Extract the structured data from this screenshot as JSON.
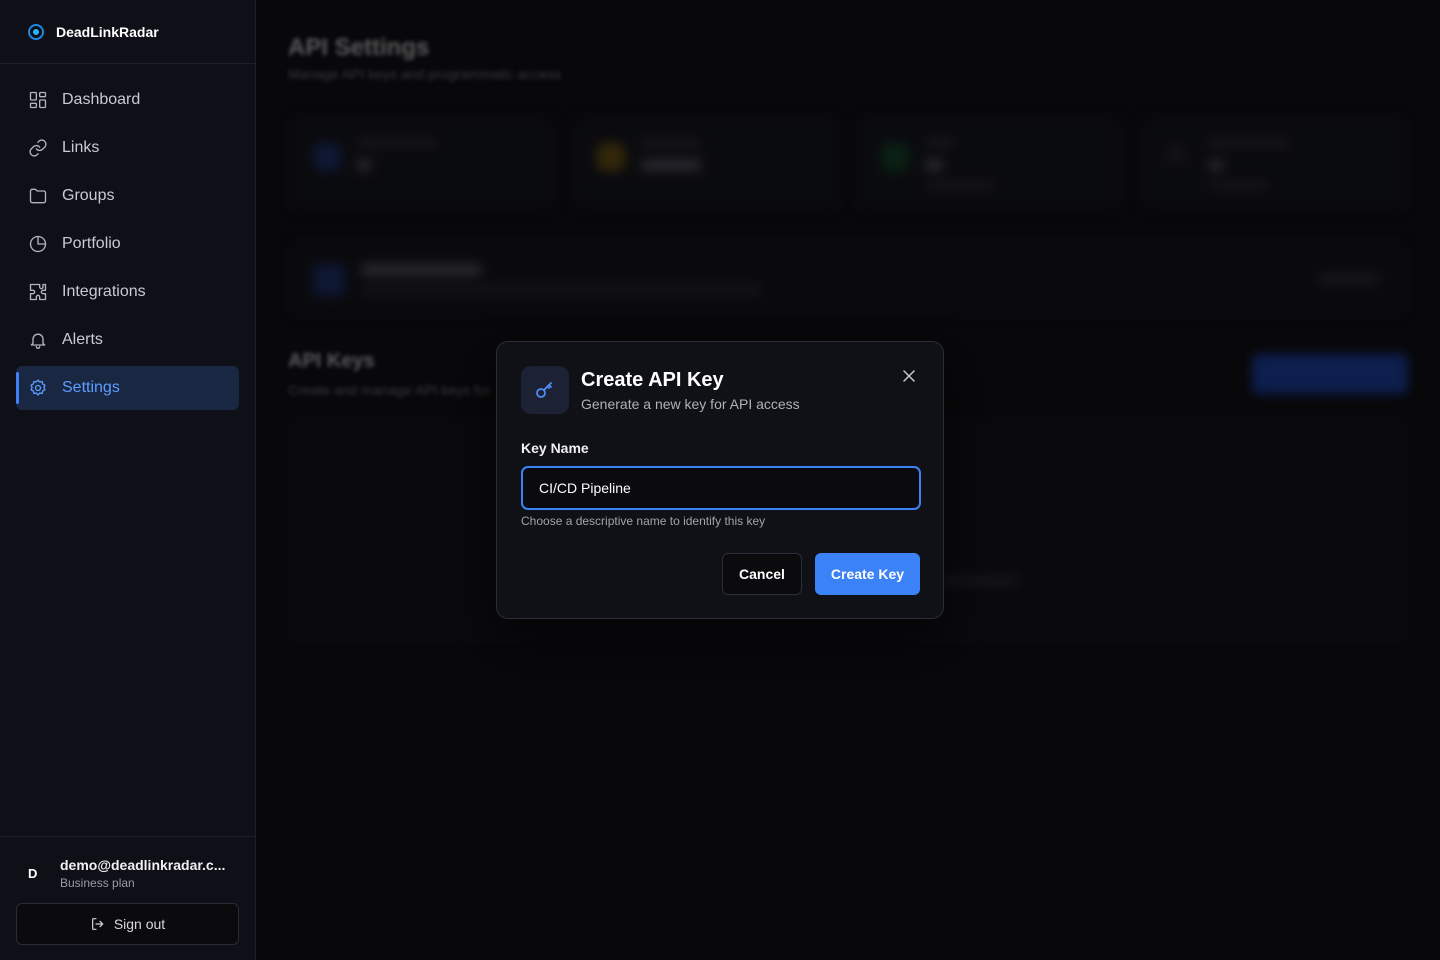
{
  "brand": {
    "name": "DeadLinkRadar",
    "icon": "radar-icon"
  },
  "sidebar": {
    "items": [
      {
        "label": "Dashboard",
        "icon": "grid-icon",
        "active": false
      },
      {
        "label": "Links",
        "icon": "link-icon",
        "active": false
      },
      {
        "label": "Groups",
        "icon": "folder-icon",
        "active": false
      },
      {
        "label": "Portfolio",
        "icon": "pie-chart-icon",
        "active": false
      },
      {
        "label": "Integrations",
        "icon": "puzzle-icon",
        "active": false
      },
      {
        "label": "Alerts",
        "icon": "bell-icon",
        "active": false
      },
      {
        "label": "Settings",
        "icon": "gear-icon",
        "active": true
      }
    ]
  },
  "user": {
    "initial": "D",
    "email": "demo@deadlinkradar.c...",
    "plan": "Business plan",
    "signout_label": "Sign out"
  },
  "page": {
    "title": "API Settings",
    "subtitle": "Manage API keys and programmatic access",
    "keys_title": "API Keys",
    "keys_subtitle": "Create and manage API keys for"
  },
  "modal": {
    "title": "Create API Key",
    "subtitle": "Generate a new key for API access",
    "field_label": "Key Name",
    "field_value": "CI/CD Pipeline",
    "field_help": "Choose a descriptive name to identify this key",
    "cancel_label": "Cancel",
    "create_label": "Create Key"
  },
  "colors": {
    "accent": "#3b82f6",
    "background": "#0b0b0e",
    "sidebar": "#0f1017"
  }
}
